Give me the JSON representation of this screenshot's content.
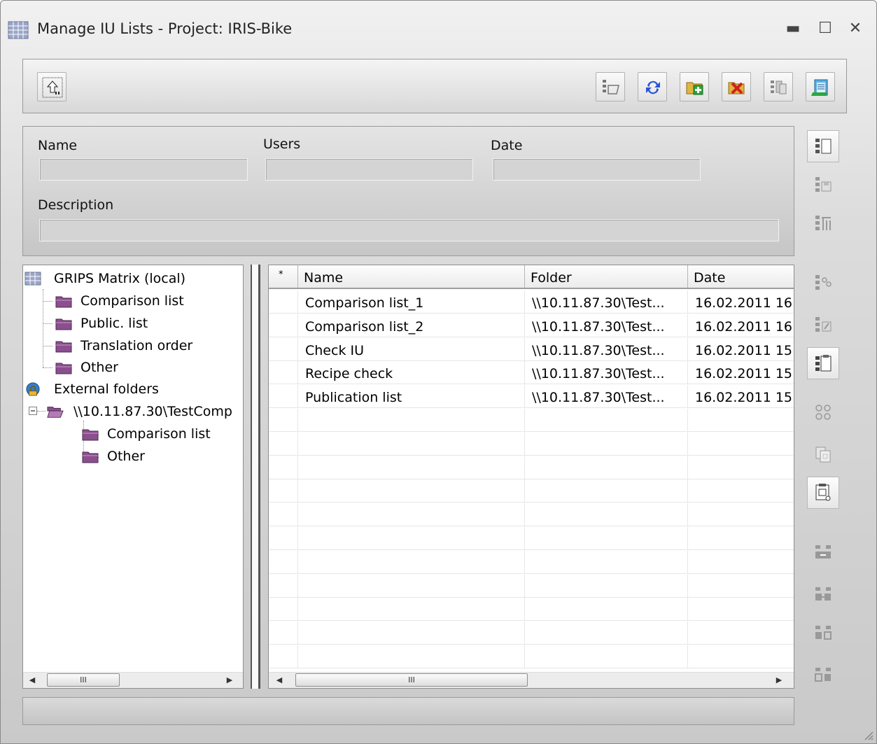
{
  "window": {
    "title": "Manage IU Lists - Project: IRIS-Bike",
    "minimize": "▬",
    "maximize": "☐",
    "close": "✕"
  },
  "toolbar": {
    "left_buttons": [
      "up-level"
    ],
    "right_buttons": [
      "open-folder",
      "refresh",
      "add-list",
      "delete-list",
      "copy-list",
      "notes"
    ]
  },
  "properties": {
    "name_label": "Name",
    "users_label": "Users",
    "date_label": "Date",
    "description_label": "Description",
    "name_value": "",
    "users_value": "",
    "date_value": "",
    "description_value": ""
  },
  "side_buttons": [
    "new-list",
    "save-list",
    "list-settings",
    "link-list",
    "edit-list",
    "clipboard",
    "users",
    "copy-iu",
    "export",
    "compare-1",
    "compare-2",
    "compare-3",
    "compare-4"
  ],
  "tree": {
    "root": "GRIPS Matrix (local)",
    "root_children": [
      "Comparison list",
      "Public. list",
      "Translation order",
      "Other"
    ],
    "external": "External folders",
    "external_folder": "\\\\10.11.87.30\\TestComp",
    "external_children": [
      "Comparison list",
      "Other"
    ]
  },
  "grid": {
    "columns": [
      "*",
      "Name",
      "Folder",
      "Date"
    ],
    "rows": [
      {
        "star": "",
        "name": "Comparison list_1",
        "folder": "\\\\10.11.87.30\\Test...",
        "date": "16.02.2011  16"
      },
      {
        "star": "",
        "name": "Comparison list_2",
        "folder": "\\\\10.11.87.30\\Test...",
        "date": "16.02.2011  16"
      },
      {
        "star": "",
        "name": "Check IU",
        "folder": "\\\\10.11.87.30\\Test...",
        "date": "16.02.2011  15"
      },
      {
        "star": "",
        "name": "Recipe check",
        "folder": "\\\\10.11.87.30\\Test...",
        "date": "16.02.2011  15"
      },
      {
        "star": "",
        "name": "Publication list",
        "folder": "\\\\10.11.87.30\\Test...",
        "date": "16.02.2011  15"
      }
    ]
  },
  "scrollbars": {
    "thumb_glyph": "III",
    "left_arrow": "◀",
    "right_arrow": "▶"
  },
  "status": {
    "text": ""
  }
}
